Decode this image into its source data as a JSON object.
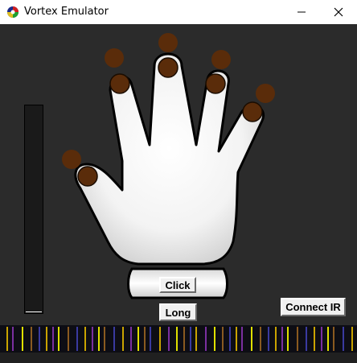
{
  "window": {
    "title": "Vortex Emulator"
  },
  "buttons": {
    "click": "Click",
    "long": "Long",
    "connect_ir": "Connect IR"
  },
  "icons": {
    "app": "vortex-app-icon",
    "minimize": "minimize-icon",
    "maximize": "maximize-icon",
    "close": "close-icon"
  },
  "colors": {
    "background": "#2b2b2b",
    "led_off": "#5a2c0a",
    "glove": "#f2f2f2",
    "led_strip_stripes": [
      "#c9a300",
      "#7a2fa0",
      "#e0e000",
      "#8a5a20",
      "#3a3aa0"
    ]
  },
  "brightness_level": 0
}
